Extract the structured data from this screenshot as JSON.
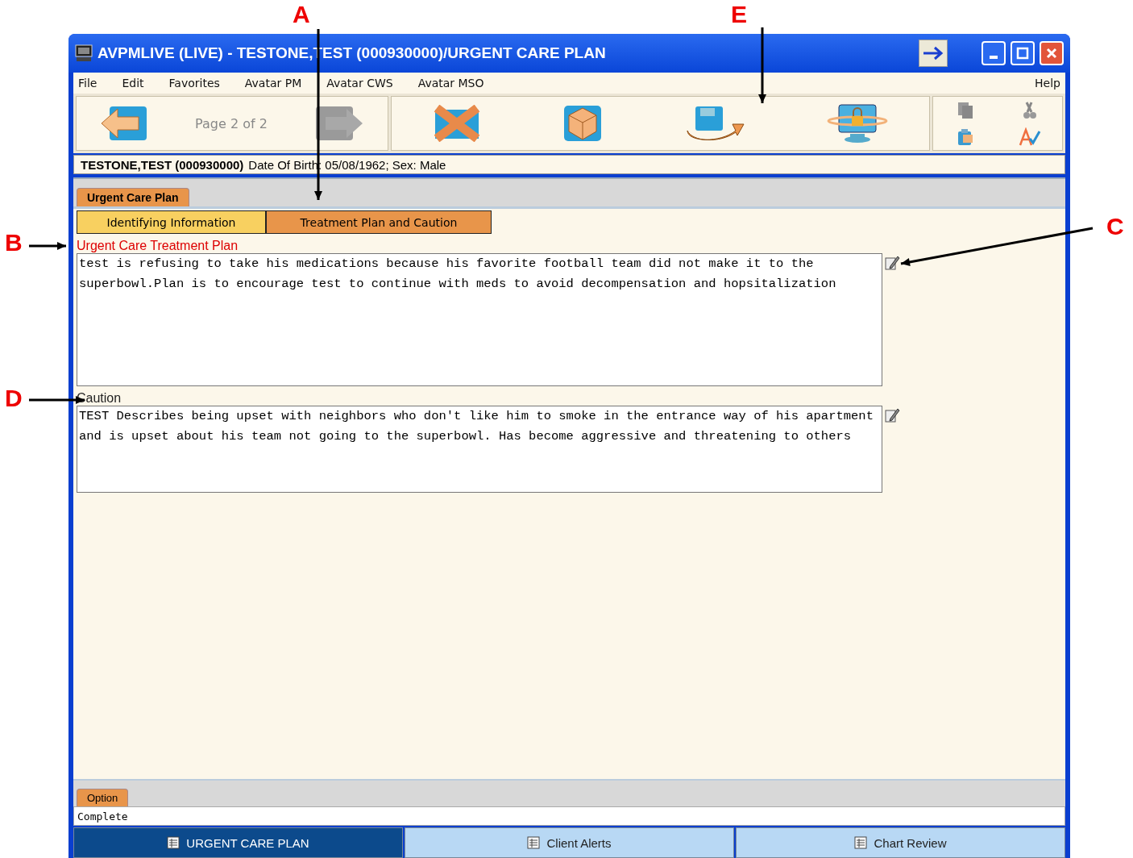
{
  "window": {
    "title": "AVPMLIVE (LIVE) - TESTONE,TEST (000930000)/URGENT CARE PLAN"
  },
  "menu": [
    {
      "label": "File"
    },
    {
      "label": "Edit"
    },
    {
      "label": "Favorites"
    },
    {
      "label": "Avatar PM"
    },
    {
      "label": "Avatar CWS"
    },
    {
      "label": "Avatar MSO"
    }
  ],
  "help_menu": "Help",
  "toolbar": {
    "page": "Page 2 of 2",
    "prev_disabled": false,
    "next_disabled": true,
    "edit_tools": [
      {
        "kind": "copy",
        "disabled": true
      },
      {
        "kind": "cut",
        "disabled": true
      },
      {
        "kind": "paste",
        "disabled": false
      },
      {
        "kind": "spell",
        "disabled": false
      }
    ]
  },
  "patient": {
    "name": "TESTONE,TEST (000930000)",
    "details": "Date Of Birth: 05/08/1962; Sex: Male"
  },
  "form_tabs": [
    {
      "label": "Urgent Care Plan",
      "selected": true
    }
  ],
  "section_tabs": [
    {
      "label": "Identifying Information",
      "selected": false
    },
    {
      "label": "Treatment Plan and Caution",
      "selected": true
    }
  ],
  "fields": [
    {
      "label": "Urgent Care Treatment Plan",
      "required": true,
      "value": "test is refusing to take his medications because his favorite football team did not make it to the superbowl.Plan is to encourage test to continue with meds to avoid decompensation and hopsitalization"
    },
    {
      "label": "Caution",
      "required": false,
      "value": "TEST Describes being upset with neighbors who don't like him to smoke in the entrance way of his apartment and is upset about his team not going to the superbowl. Has become aggressive and threatening to others"
    }
  ],
  "option_tab": "Option",
  "status": "Complete",
  "taskbar": [
    {
      "label": "URGENT CARE PLAN",
      "selected": true
    },
    {
      "label": "Client Alerts",
      "selected": false
    },
    {
      "label": "Chart Review",
      "selected": false
    }
  ],
  "annotations": [
    {
      "label": "A"
    },
    {
      "label": "E"
    },
    {
      "label": "B"
    },
    {
      "label": "C"
    },
    {
      "label": "D"
    }
  ]
}
